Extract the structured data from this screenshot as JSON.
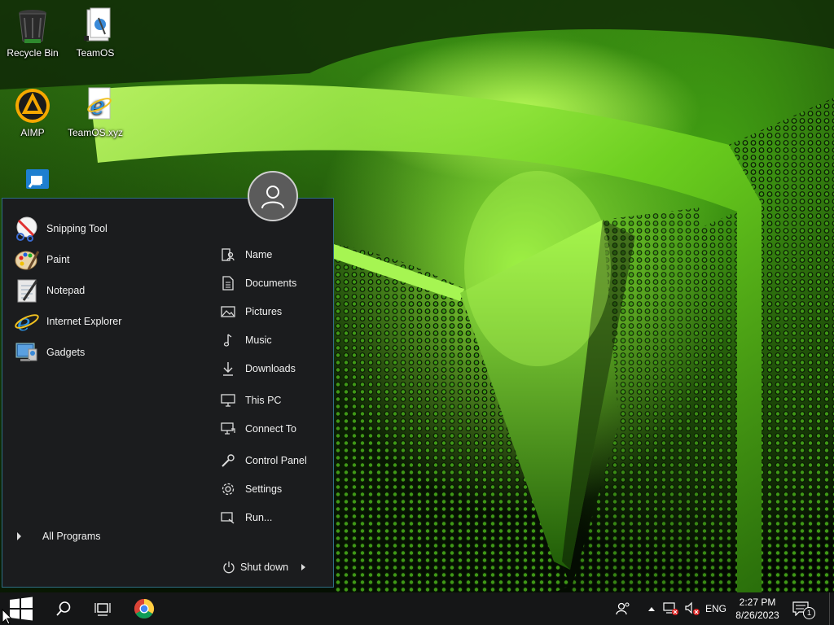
{
  "desktop": {
    "icons": [
      {
        "label": "Recycle Bin",
        "icon": "recycle-bin-icon"
      },
      {
        "label": "TeamOS",
        "icon": "folder-icon"
      },
      {
        "label": "AIMP",
        "icon": "aimp-icon"
      },
      {
        "label": "TeamOS.xyz",
        "icon": "internet-explorer-icon"
      },
      {
        "label": "",
        "icon": "shortcut-app-icon"
      }
    ]
  },
  "start_menu": {
    "user_icon": "user-avatar-icon",
    "programs": [
      {
        "label": "Snipping Tool",
        "icon": "snipping-tool-icon"
      },
      {
        "label": "Paint",
        "icon": "paint-icon"
      },
      {
        "label": "Notepad",
        "icon": "notepad-icon"
      },
      {
        "label": "Internet Explorer",
        "icon": "internet-explorer-icon"
      },
      {
        "label": "Gadgets",
        "icon": "gadgets-icon"
      }
    ],
    "all_programs": "All Programs",
    "places": [
      {
        "label": "Name",
        "icon": "user-folder-icon"
      },
      {
        "label": "Documents",
        "icon": "documents-icon"
      },
      {
        "label": "Pictures",
        "icon": "pictures-icon"
      },
      {
        "label": "Music",
        "icon": "music-icon"
      },
      {
        "label": "Downloads",
        "icon": "downloads-icon"
      },
      {
        "label": "This PC",
        "icon": "computer-icon"
      },
      {
        "label": "Connect To",
        "icon": "connect-to-icon"
      },
      {
        "label": "Control Panel",
        "icon": "control-panel-icon"
      },
      {
        "label": "Settings",
        "icon": "settings-gear-icon"
      },
      {
        "label": "Run...",
        "icon": "run-icon"
      }
    ],
    "shutdown": "Shut down"
  },
  "taskbar": {
    "language": "ENG",
    "time": "2:27 PM",
    "date": "8/26/2023",
    "notification_count": "1"
  },
  "colors": {
    "menu_bg": "#1b1c1e",
    "menu_border": "#2f6e86",
    "taskbar_bg": "#151617",
    "wallpaper_accent": "#7ad62a"
  }
}
